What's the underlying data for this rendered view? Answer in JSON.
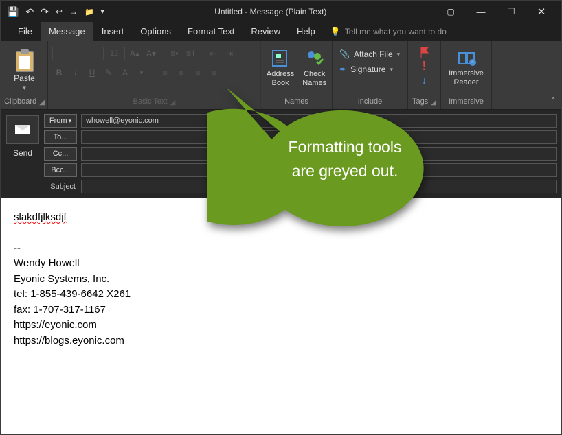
{
  "titlebar": {
    "title": "Untitled  -  Message (Plain Text)"
  },
  "menu": {
    "file": "File",
    "message": "Message",
    "insert": "Insert",
    "options": "Options",
    "format_text": "Format Text",
    "review": "Review",
    "help": "Help",
    "tellme": "Tell me what you want to do"
  },
  "ribbon": {
    "clipboard": {
      "paste": "Paste",
      "label": "Clipboard"
    },
    "basic_text": {
      "label": "Basic Text",
      "size_placeholder": "12"
    },
    "names": {
      "address_book": "Address\nBook",
      "check_names": "Check\nNames",
      "label": "Names"
    },
    "include": {
      "attach_file": "Attach File",
      "signature": "Signature",
      "label": "Include"
    },
    "tags": {
      "label": "Tags"
    },
    "immersive": {
      "reader": "Immersive\nReader",
      "label": "Immersive"
    }
  },
  "compose": {
    "send": "Send",
    "from_label": "From",
    "from_value": "whowell@eyonic.com",
    "to_label": "To...",
    "cc_label": "Cc...",
    "bcc_label": "Bcc...",
    "subject_label": "Subject"
  },
  "body": {
    "typed": "slakdfjlksdjf",
    "sig_sep": "--",
    "name": "Wendy Howell",
    "company": "Eyonic Systems, Inc.",
    "tel": "tel: 1-855-439-6642 X261",
    "fax": "fax: 1-707-317-1167",
    "url1": "https://eyonic.com",
    "url2": "https://blogs.eyonic.com"
  },
  "callout": {
    "line1": "Formatting tools",
    "line2": "are greyed out."
  }
}
